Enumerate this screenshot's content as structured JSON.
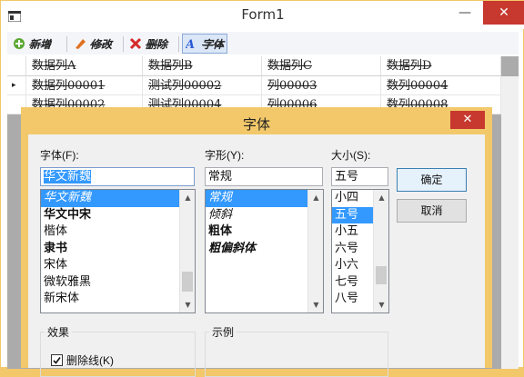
{
  "window": {
    "title": "Form1",
    "min": "—",
    "max": "☐",
    "close": "✕"
  },
  "toolbar": {
    "items": [
      {
        "label": "新增",
        "icon": "add-icon"
      },
      {
        "label": "修改",
        "icon": "edit-icon"
      },
      {
        "label": "删除",
        "icon": "delete-icon"
      },
      {
        "label": "字体",
        "icon": "font-icon"
      }
    ]
  },
  "grid": {
    "columns": [
      "数据列A",
      "数据列B",
      "数据列C",
      "数据列D"
    ],
    "rows": [
      [
        "数据列00001",
        "测试列00002",
        "列00003",
        "数列00004"
      ],
      [
        "数据列00002",
        "测试列00004",
        "列00006",
        "数列00008"
      ]
    ],
    "row_indicator": "▸"
  },
  "font_dialog": {
    "title": "字体",
    "close": "✕",
    "font_label": "字体(F):",
    "style_label": "字形(Y):",
    "size_label": "大小(S):",
    "font_value": "华文新魏",
    "style_value": "常规",
    "size_value": "五号",
    "fonts": [
      "华文新魏",
      "华文中宋",
      "楷体",
      "隶书",
      "宋体",
      "微软雅黑",
      "新宋体"
    ],
    "styles": [
      "常规",
      "倾斜",
      "粗体",
      "粗偏斜体"
    ],
    "sizes": [
      "小四",
      "五号",
      "小五",
      "六号",
      "小六",
      "七号",
      "八号"
    ],
    "ok": "确定",
    "cancel": "取消",
    "effects_label": "效果",
    "strikeout_label": "删除线(K)",
    "sample_label": "示例"
  }
}
